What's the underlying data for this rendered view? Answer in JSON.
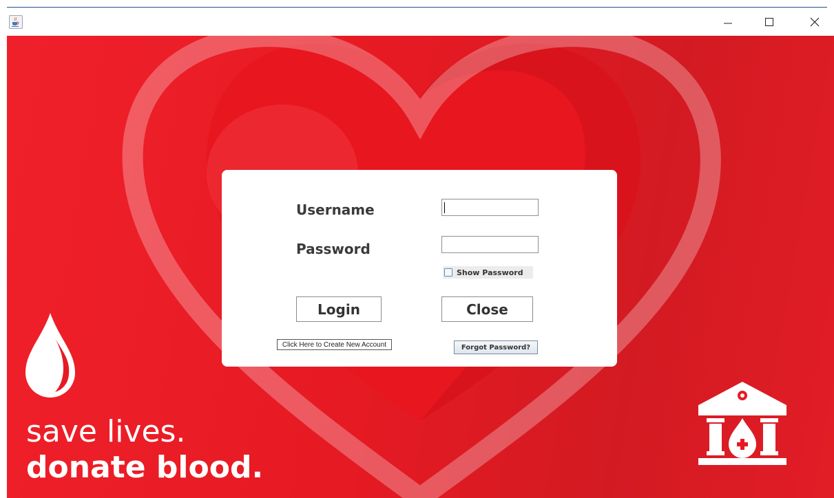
{
  "window": {
    "icon": "java-coffee-icon",
    "controls": [
      "minimize-icon",
      "maximize-icon",
      "close-icon"
    ]
  },
  "login": {
    "username_label": "Username",
    "password_label": "Password",
    "username_value": "",
    "password_value": "",
    "show_password_label": "Show Password",
    "show_password_checked": false,
    "login_button": "Login",
    "close_button": "Close",
    "create_account_button": "Click Here to Create New Account",
    "forgot_password_button": "Forgot Password?"
  },
  "branding": {
    "line1": "save lives.",
    "line2": "donate blood.",
    "drop_icon": "blood-drop-icon",
    "hospital_icon": "blood-bank-building-icon"
  },
  "colors": {
    "background_red": "#e61a23",
    "panel": "#ffffff",
    "text": "#3a3a3a"
  }
}
